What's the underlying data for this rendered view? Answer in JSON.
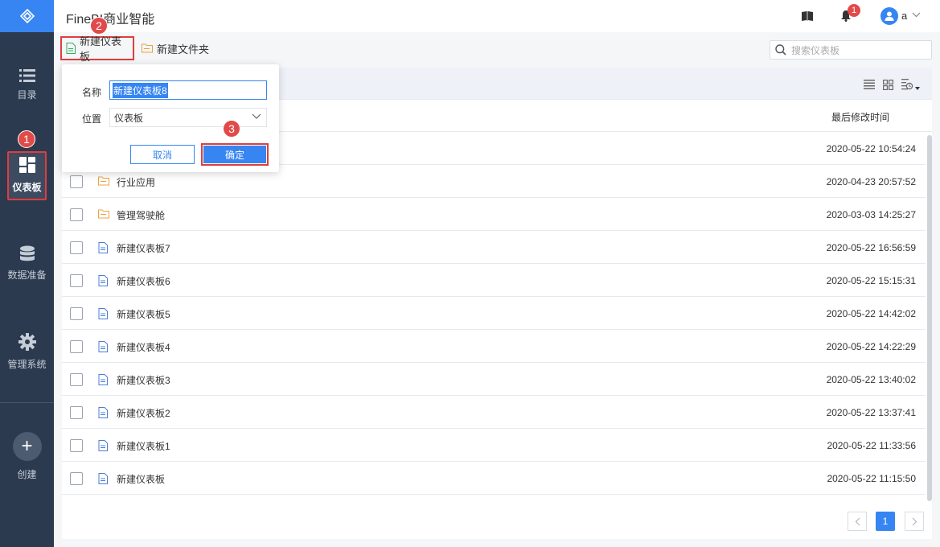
{
  "app": {
    "title": "FineBI商业智能"
  },
  "sidebar": {
    "items": [
      {
        "label": "目录",
        "icon": "list-icon"
      },
      {
        "label": "仪表板",
        "icon": "dashboard-icon",
        "active": true
      },
      {
        "label": "数据准备",
        "icon": "database-icon"
      },
      {
        "label": "管理系统",
        "icon": "gear-icon"
      },
      {
        "label": "创建",
        "icon": "plus-icon"
      }
    ]
  },
  "header": {
    "notification_count": "1",
    "user_name": "a"
  },
  "annotations": {
    "step1": "1",
    "step2": "2",
    "step3": "3"
  },
  "toolbar": {
    "new_dashboard_label": "新建仪表板",
    "new_folder_label": "新建文件夹",
    "search_placeholder": "搜索仪表板"
  },
  "table": {
    "column_time": "最后修改时间",
    "rows": [
      {
        "name": "",
        "type": "folder",
        "time": "2020-05-22 10:54:24"
      },
      {
        "name": "行业应用",
        "type": "folder",
        "time": "2020-04-23 20:57:52"
      },
      {
        "name": "管理驾驶舱",
        "type": "folder",
        "time": "2020-03-03 14:25:27"
      },
      {
        "name": "新建仪表板7",
        "type": "file",
        "time": "2020-05-22 16:56:59"
      },
      {
        "name": "新建仪表板6",
        "type": "file",
        "time": "2020-05-22 15:15:31"
      },
      {
        "name": "新建仪表板5",
        "type": "file",
        "time": "2020-05-22 14:42:02"
      },
      {
        "name": "新建仪表板4",
        "type": "file",
        "time": "2020-05-22 14:22:29"
      },
      {
        "name": "新建仪表板3",
        "type": "file",
        "time": "2020-05-22 13:40:02"
      },
      {
        "name": "新建仪表板2",
        "type": "file",
        "time": "2020-05-22 13:37:41"
      },
      {
        "name": "新建仪表板1",
        "type": "file",
        "time": "2020-05-22 11:33:56"
      },
      {
        "name": "新建仪表板",
        "type": "file",
        "time": "2020-05-22 11:15:50"
      }
    ]
  },
  "pagination": {
    "current": "1"
  },
  "dialog": {
    "name_label": "名称",
    "name_value": "新建仪表板8",
    "location_label": "位置",
    "location_value": "仪表板",
    "cancel_label": "取消",
    "ok_label": "确定"
  },
  "colors": {
    "accent": "#3685f2",
    "sidebar": "#2c3a4f",
    "highlight": "#e03d3d",
    "folder": "#f0a03c",
    "file": "#4a7fd6"
  }
}
